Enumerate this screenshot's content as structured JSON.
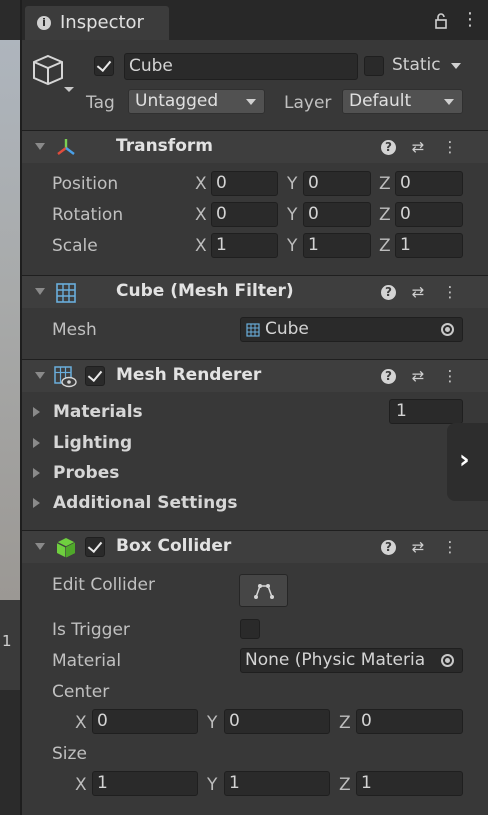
{
  "left_panel": {
    "fragment": "1"
  },
  "tab": {
    "title": "Inspector"
  },
  "object": {
    "active": true,
    "name": "Cube",
    "static_label": "Static",
    "static_checked": false,
    "tag_label": "Tag",
    "tag_value": "Untagged",
    "layer_label": "Layer",
    "layer_value": "Default"
  },
  "transform": {
    "title": "Transform",
    "rows": [
      {
        "label": "Position",
        "x": "0",
        "y": "0",
        "z": "0"
      },
      {
        "label": "Rotation",
        "x": "0",
        "y": "0",
        "z": "0"
      },
      {
        "label": "Scale",
        "x": "1",
        "y": "1",
        "z": "1"
      }
    ]
  },
  "axes": {
    "x": "X",
    "y": "Y",
    "z": "Z"
  },
  "mesh_filter": {
    "title": "Cube (Mesh Filter)",
    "mesh_label": "Mesh",
    "mesh_value": "Cube"
  },
  "mesh_renderer": {
    "title": "Mesh Renderer",
    "enabled": true,
    "materials_label": "Materials",
    "materials_count": "1",
    "lighting_label": "Lighting",
    "probes_label": "Probes",
    "additional_label": "Additional Settings"
  },
  "box_collider": {
    "title": "Box Collider",
    "enabled": true,
    "edit_collider_label": "Edit Collider",
    "is_trigger_label": "Is Trigger",
    "is_trigger": false,
    "material_label": "Material",
    "material_value": "None (Physic Materia",
    "center_label": "Center",
    "center": {
      "x": "0",
      "y": "0",
      "z": "0"
    },
    "size_label": "Size",
    "size": {
      "x": "1",
      "y": "1",
      "z": "1"
    }
  },
  "header_buttons": {
    "help": "?",
    "presets": "⇄",
    "more": "⋮"
  },
  "colors": {
    "background": "#383838",
    "header": "#3e3e3e",
    "field": "#2a2a2a",
    "collider_green": "#6fcf3f",
    "transform_red": "#e04c3c",
    "transform_blue": "#4aa0e8",
    "mesh_blue": "#6aaedc"
  }
}
